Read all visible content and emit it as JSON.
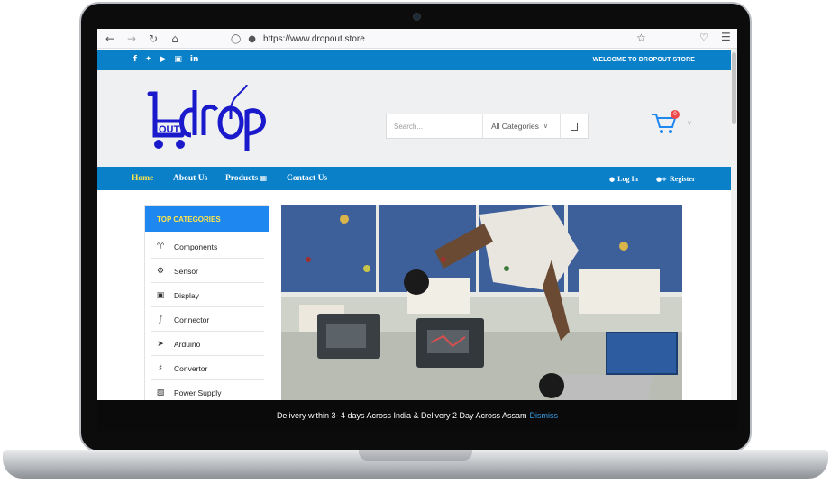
{
  "browser": {
    "back_icon": "arrow-left-icon",
    "forward_icon": "arrow-right-icon",
    "reload_icon": "reload-icon",
    "home_icon": "home-icon",
    "url": "https://www.dropout.store"
  },
  "topbar": {
    "social": [
      "f",
      "t",
      "yt",
      "ig",
      "in"
    ],
    "welcome": "WELCOME TO DROPOUT STORE"
  },
  "logo": {
    "text": "drop",
    "sub": "OUT"
  },
  "search": {
    "placeholder": "Search...",
    "category": "All Categories"
  },
  "cart": {
    "count": "0"
  },
  "nav": {
    "home": "Home",
    "about": "About Us",
    "products": "Products",
    "contact": "Contact Us",
    "login": "Log In",
    "register": "Register"
  },
  "sidebar": {
    "title": "TOP CATEGORIES",
    "items": [
      {
        "label": "Components",
        "icon": "component-icon"
      },
      {
        "label": "Sensor",
        "icon": "sensor-icon"
      },
      {
        "label": "Display",
        "icon": "display-icon"
      },
      {
        "label": "Connector",
        "icon": "connector-icon"
      },
      {
        "label": "Arduino",
        "icon": "arduino-icon"
      },
      {
        "label": "Convertor",
        "icon": "convertor-icon"
      },
      {
        "label": "Power Supply",
        "icon": "power-supply-icon"
      }
    ]
  },
  "notice": {
    "text": "Delivery within 3- 4 days Across India & Delivery 2 Day Across Assam",
    "dismiss": "Dismiss"
  },
  "colors": {
    "brand_blue": "#0a80c8",
    "accent_yellow": "#ffe44a",
    "logo_blue": "#1a1acc"
  }
}
